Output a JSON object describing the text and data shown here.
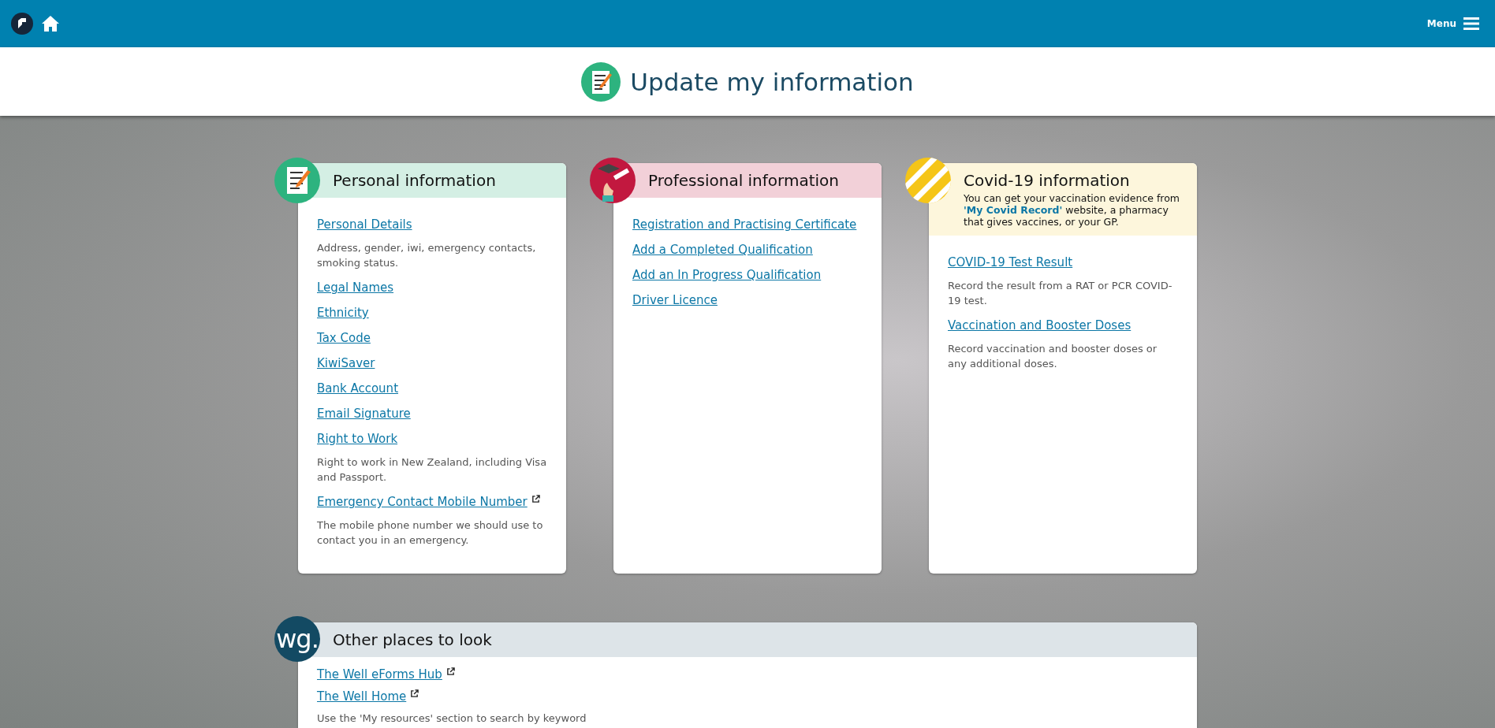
{
  "top_bar": {
    "menu_label": "Menu"
  },
  "page_title": "Update my information",
  "cards": [
    {
      "kind": "personal",
      "title": "Personal information",
      "items": [
        {
          "label": "Personal Details",
          "external": false,
          "description": "Address, gender, iwi, emergency contacts, smoking status."
        },
        {
          "label": "Legal Names",
          "external": false
        },
        {
          "label": "Ethnicity",
          "external": false
        },
        {
          "label": "Tax Code",
          "external": false
        },
        {
          "label": "KiwiSaver",
          "external": false
        },
        {
          "label": "Bank Account",
          "external": false
        },
        {
          "label": "Email Signature",
          "external": false
        },
        {
          "label": "Right to Work",
          "external": false,
          "description": "Right to work in New Zealand, including Visa and Passport."
        },
        {
          "label": "Emergency Contact Mobile Number",
          "external": true,
          "description": "The mobile phone number we should use to contact you in an emergency."
        }
      ]
    },
    {
      "kind": "professional",
      "title": "Professional information",
      "items": [
        {
          "label": "Registration and Practising Certificate",
          "external": false
        },
        {
          "label": "Add a Completed Qualification",
          "external": false
        },
        {
          "label": "Add an In Progress Qualification",
          "external": false
        },
        {
          "label": "Driver Licence",
          "external": false
        }
      ]
    },
    {
      "kind": "covid",
      "title": "Covid-19 information",
      "note": {
        "before": "You can get your vaccination evidence from ",
        "link": "'My Covid Record'",
        "after": " website, a pharmacy that gives vaccines, or your GP."
      },
      "items": [
        {
          "label": "COVID-19 Test Result",
          "external": false,
          "description": "Record the result from a RAT or PCR COVID-19 test."
        },
        {
          "label": "Vaccination and Booster Doses",
          "external": false,
          "description": "Record vaccination and booster doses or any additional doses."
        }
      ]
    }
  ],
  "other": {
    "logo_text": "wg.",
    "title": "Other places to look",
    "items": [
      {
        "label": "The Well eForms Hub",
        "external": true
      },
      {
        "label": "The Well Home",
        "external": true
      }
    ],
    "hint": "Use the 'My resources' section to search by keyword"
  }
}
